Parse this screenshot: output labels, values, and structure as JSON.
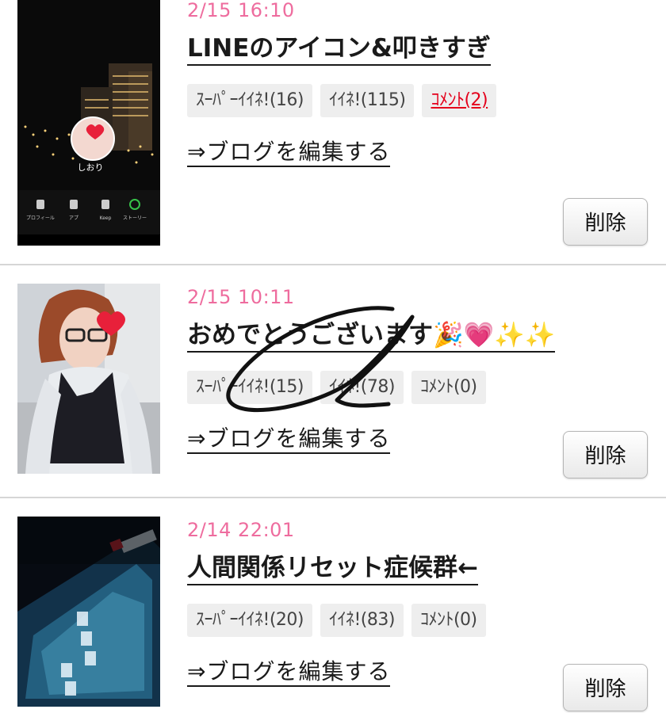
{
  "posts": [
    {
      "date": "2/15 16:10",
      "title": "LINEのアイコン&叩きすぎ",
      "title_emoji": "",
      "super_like": "ｽｰﾊﾟｰｲｲﾈ!(16)",
      "like": "ｲｲﾈ!(115)",
      "comment": "ｺﾒﾝﾄ(2)",
      "edit_label": "⇒ブログを編集する",
      "delete_label": "削除",
      "thumb_profile_name": "しおり",
      "thumb_menu": [
        "プロフィール",
        "アプ",
        "Keep",
        "ストーリー"
      ]
    },
    {
      "date": "2/15 10:11",
      "title": "おめでとうございます",
      "title_emoji": "🎉💗✨✨",
      "super_like": "ｽｰﾊﾟｰｲｲﾈ!(15)",
      "like": "ｲｲﾈ!(78)",
      "comment": "ｺﾒﾝﾄ(0)",
      "edit_label": "⇒ブログを編集する",
      "delete_label": "削除"
    },
    {
      "date": "2/14 22:01",
      "title": "人間関係リセット症候群←",
      "title_emoji": "",
      "super_like": "ｽｰﾊﾟｰｲｲﾈ!(20)",
      "like": "ｲｲﾈ!(83)",
      "comment": "ｺﾒﾝﾄ(0)",
      "edit_label": "⇒ブログを編集する",
      "delete_label": "削除"
    }
  ],
  "colors": {
    "date_pink": "#ee6c9e",
    "comment_red": "#e4001b",
    "tag_bg": "#eeeeee",
    "separator": "#d6d6d6"
  }
}
